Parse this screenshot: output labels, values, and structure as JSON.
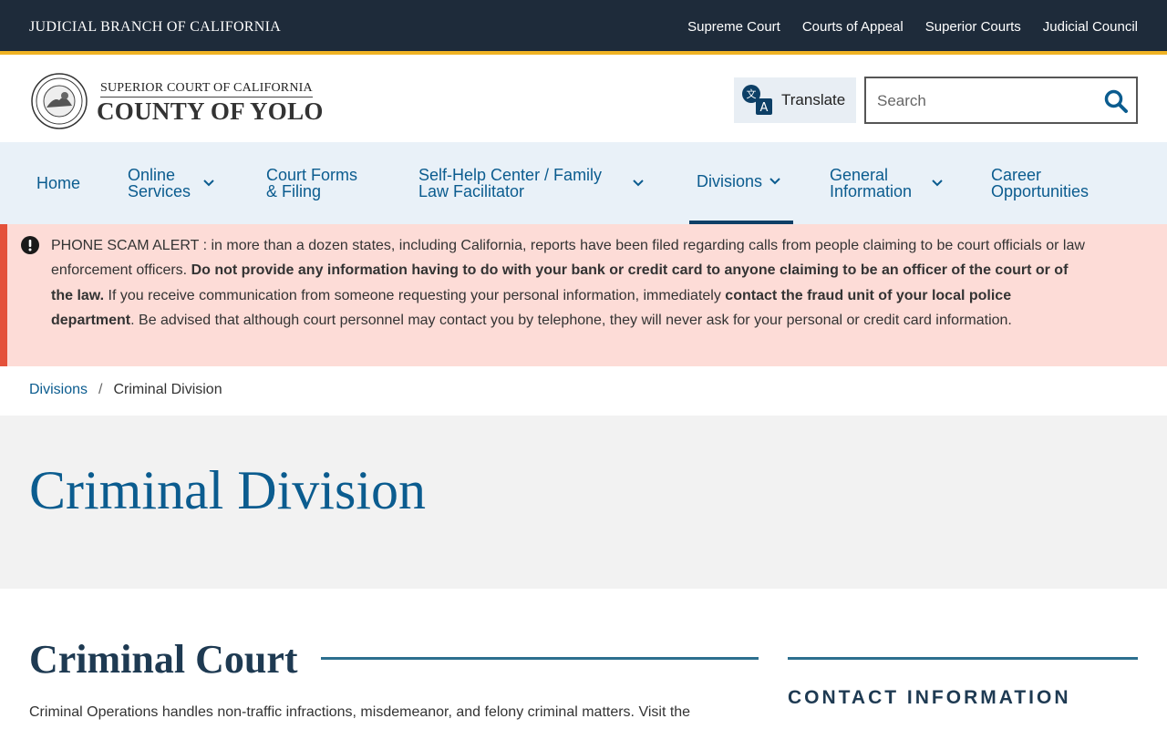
{
  "topbar": {
    "brand": "JUDICIAL BRANCH OF CALIFORNIA",
    "links": [
      "Supreme Court",
      "Courts of Appeal",
      "Superior Courts",
      "Judicial Council"
    ]
  },
  "header": {
    "logo_small": "SUPERIOR COURT OF CALIFORNIA",
    "logo_big": "COUNTY OF YOLO",
    "translate_label": "Translate",
    "search_placeholder": "Search"
  },
  "nav": {
    "items": [
      {
        "line1": "Home",
        "line2": ""
      },
      {
        "line1": "Online",
        "line2": "Services"
      },
      {
        "line1": "Court Forms",
        "line2": "& Filing"
      },
      {
        "line1": "Self-Help Center / Family",
        "line2": "Law Facilitator"
      },
      {
        "line1": "Divisions",
        "line2": ""
      },
      {
        "line1": "General",
        "line2": "Information"
      },
      {
        "line1": "Career",
        "line2": "Opportunities"
      }
    ]
  },
  "alert": {
    "p1": "PHONE SCAM ALERT",
    "p2": " : in more than a dozen states, including California, reports have been filed regarding calls from people claiming to be court officials or law enforcement officers. ",
    "p3": "Do not provide any information having to do with your bank or credit card to anyone claiming to be an officer of the court or of the law.",
    "p4": " If you receive communication from someone requesting your personal information, immediately ",
    "p5": "contact the fraud unit of your local police department",
    "p6": ". Be advised that although court personnel may contact you by telephone, they will never ask for your personal or credit card information."
  },
  "breadcrumb": {
    "parent": "Divisions",
    "separator": "/",
    "current": "Criminal Division"
  },
  "page": {
    "title": "Criminal Division",
    "section_title": "Criminal Court",
    "intro": "Criminal Operations handles non-traffic infractions, misdemeanor, and felony criminal matters. Visit the",
    "sidebar_heading": "CONTACT INFORMATION"
  },
  "colors": {
    "topbar_bg": "#1e2b3a",
    "accent_gold": "#f0b323",
    "link_blue": "#0b5c8f",
    "alert_bg": "#fddcd7",
    "alert_border": "#e4513a"
  }
}
